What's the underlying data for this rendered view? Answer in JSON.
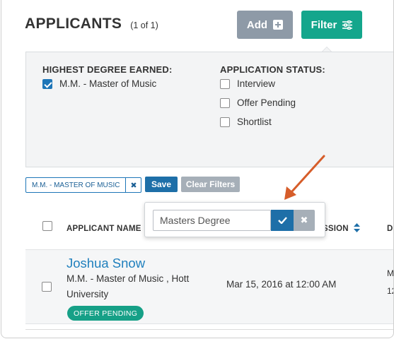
{
  "header": {
    "title": "APPLICANTS",
    "count": "(1 of 1)"
  },
  "toolbar": {
    "add_label": "Add",
    "filter_label": "Filter"
  },
  "filters": {
    "degree": {
      "title": "HIGHEST DEGREE EARNED:",
      "options": [
        {
          "label": "M.M. - Master of Music",
          "checked": true
        }
      ]
    },
    "status": {
      "title": "APPLICATION STATUS:",
      "options": [
        {
          "label": "Interview",
          "checked": false
        },
        {
          "label": "Offer Pending",
          "checked": false
        },
        {
          "label": "Shortlist",
          "checked": false
        }
      ]
    }
  },
  "active_filters": {
    "chip_label": "M.M. - MASTER OF MUSIC",
    "remove_glyph": "✖",
    "save_label": "Save",
    "clear_label": "Clear Filters"
  },
  "popover": {
    "input_value": "Masters Degree",
    "confirm_icon": "check-icon",
    "cancel_glyph": "✖"
  },
  "table": {
    "columns": {
      "name": "APPLICANT NAME",
      "submission_partial": "SSION",
      "sort_icon": "sort-icon",
      "cut_col": "D"
    },
    "rows": [
      {
        "name": "Joshua Snow",
        "degree": "M.M. - Master of Music , Hott University",
        "status_badge": "OFFER PENDING",
        "date": "Mar 15, 2016 at 12:00 AM",
        "cut_top": "M",
        "cut_bottom": "12"
      }
    ]
  },
  "colors": {
    "accent_teal": "#14a68c",
    "primary_blue": "#1e6fa8",
    "neutral_gray": "#8e9aa7",
    "arrow": "#d65d2a"
  }
}
